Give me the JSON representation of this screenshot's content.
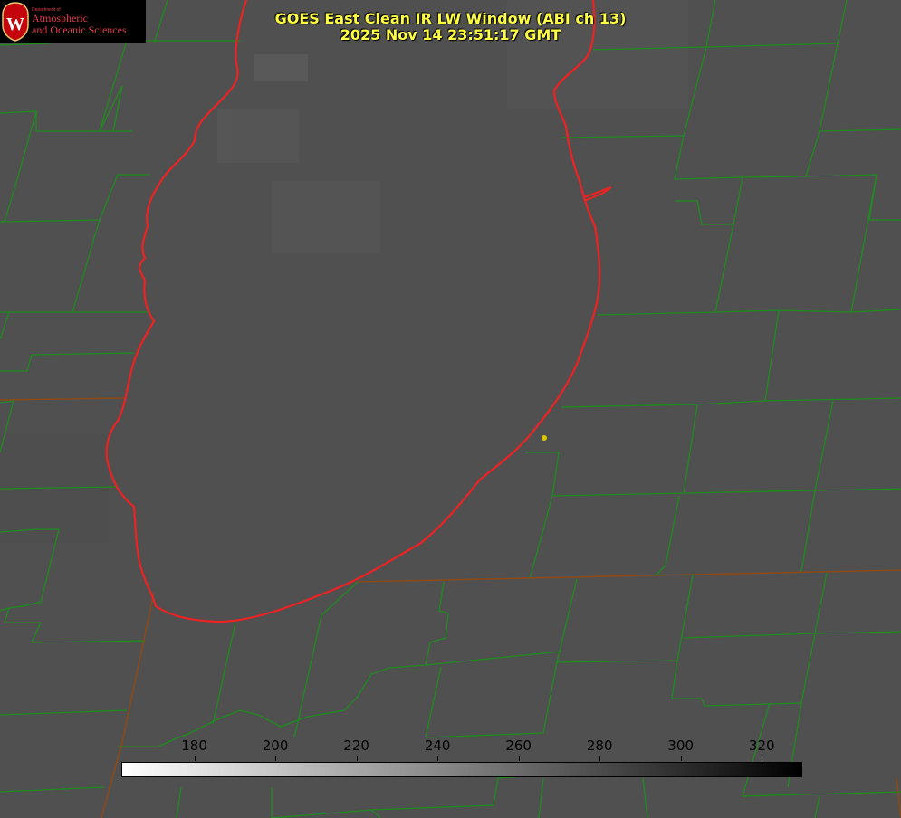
{
  "title_line1": "GOES East Clean IR LW Window (ABI ch 13)",
  "title_line2": "2025 Nov 14 23:51:17 GMT",
  "logo": {
    "department": "Department of",
    "line1": "Atmospheric",
    "line2": "and Oceanic Sciences",
    "crest_letter": "W"
  },
  "colorbar": {
    "min": 162,
    "max": 330,
    "ticks": [
      "180",
      "200",
      "220",
      "240",
      "260",
      "280",
      "300",
      "320"
    ],
    "gradient_start": "#ffffff",
    "gradient_end": "#000000"
  },
  "colors": {
    "background": "#505050",
    "lake_outline": "#ee2222",
    "county_lines": "#1e8c1e",
    "title": "#ffff44",
    "marker": "#d8c800"
  }
}
